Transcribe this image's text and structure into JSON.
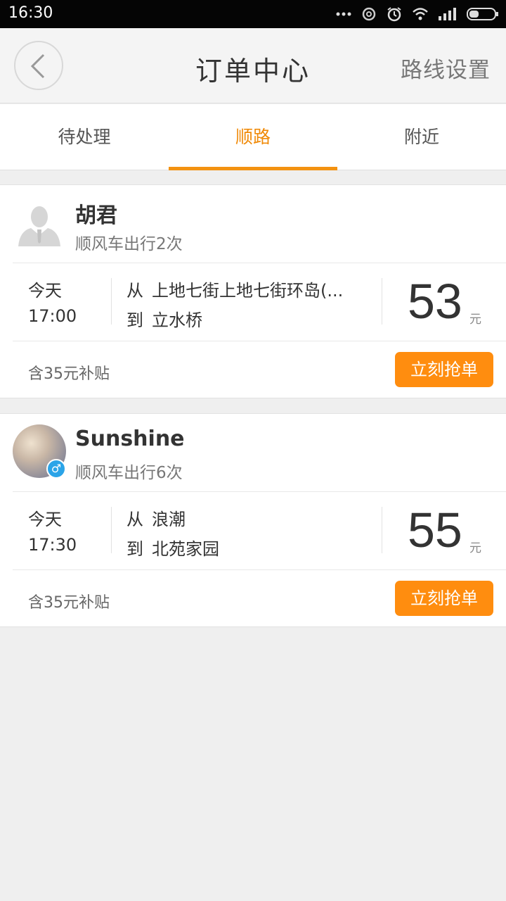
{
  "status_bar": {
    "time": "16:30"
  },
  "header": {
    "title": "订单中心",
    "route_settings": "路线设置"
  },
  "tabs": [
    {
      "label": "待处理"
    },
    {
      "label": "顺路"
    },
    {
      "label": "附近"
    }
  ],
  "active_tab": "顺路",
  "colors": {
    "accent": "#f39211",
    "button": "#ff8d0f",
    "gender_badge": "#2ba4e8"
  },
  "orders": [
    {
      "name": "胡君",
      "trips": "顺风车出行2次",
      "day": "今天",
      "time": "17:00",
      "from_label": "从",
      "from": "上地七街上地七街环岛(...",
      "to_label": "到",
      "to": "立水桥",
      "price": "53",
      "currency": "元",
      "subsidy": "含35元补贴",
      "action": "立刻抢单",
      "avatar": "default-person-icon"
    },
    {
      "name": "Sunshine",
      "trips": "顺风车出行6次",
      "day": "今天",
      "time": "17:30",
      "from_label": "从",
      "from": "浪潮",
      "to_label": "到",
      "to": "北苑家园",
      "price": "55",
      "currency": "元",
      "subsidy": "含35元补贴",
      "action": "立刻抢单",
      "avatar": "photo",
      "gender": "♂"
    }
  ]
}
